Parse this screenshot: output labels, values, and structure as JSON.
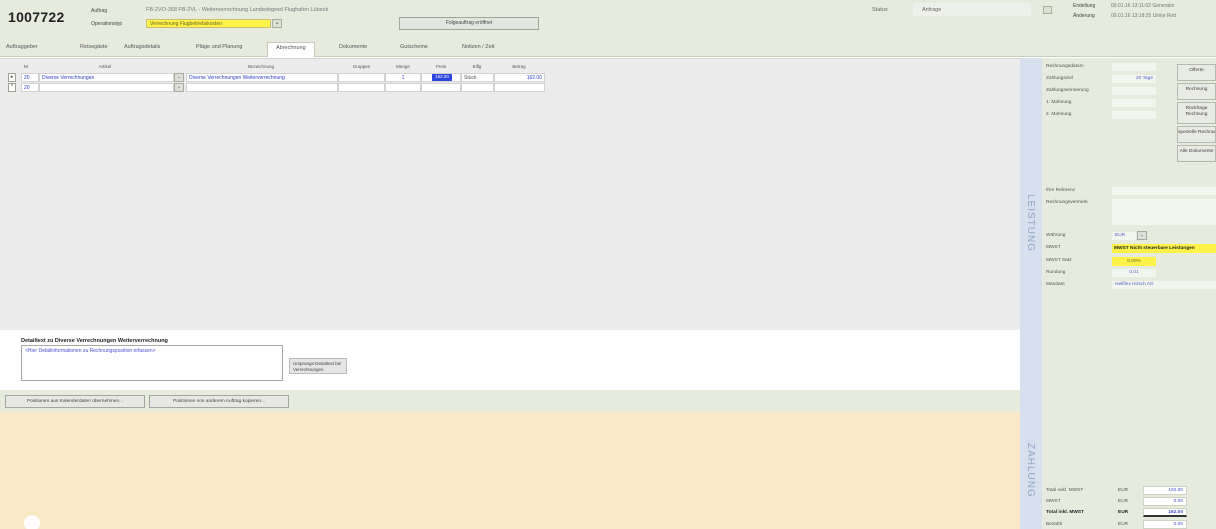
{
  "header": {
    "order_number": "1007722",
    "label_auftrag": "Auftrag",
    "label_operationstyp": "Operationstyp",
    "auftrag_value": "FB-2VO-368 FB-2VL - Weiterverrechnung Landedegesd Flughafen Lübeck",
    "operationstyp_value": "Verrechnung Flugbetriebskosten",
    "followup_button": "Folgeauftrag eröffnet",
    "status_label": "Status",
    "status_value": "Anfrage",
    "erstellung_label": "Erstellung",
    "erstellung_value": "09.01.16 13:11:02 Generator",
    "aenderung_label": "Änderung",
    "aenderung_value": "09.01.16 13:18:25 Ulrike Rott"
  },
  "tabs": [
    {
      "label": "Auftraggeber",
      "active": false
    },
    {
      "label": "Reisegäste",
      "active": false
    },
    {
      "label": "Auftragsdetails",
      "active": false
    },
    {
      "label": "Pläge und Planung",
      "active": false
    },
    {
      "label": "Abrechnung",
      "active": true
    },
    {
      "label": "Dokumente",
      "active": false
    },
    {
      "label": "Gutscheine",
      "active": false
    },
    {
      "label": "Notizen / Zeit",
      "active": false
    }
  ],
  "grid": {
    "columns": {
      "nr": "Nr",
      "artikel": "Artikel",
      "bezeichnung": "Bezeichnung",
      "gruppe": "Gruppen",
      "menge": "Menge",
      "preis": "Preis",
      "einheit": "Eiflg",
      "betrag": "Betrag"
    },
    "rows": [
      {
        "marker": "▸",
        "nr": "20",
        "artikel": "Diverse Verrechnungen",
        "bezeichnung": "Diverse Verrechnungen Weiterverrechnung",
        "gruppe": "",
        "menge": "1",
        "preis": "162.00",
        "einheit": "Stück",
        "betrag": "162.00"
      },
      {
        "marker": "*",
        "nr": "20",
        "artikel": "",
        "bezeichnung": "",
        "gruppe": "",
        "menge": "",
        "preis": "",
        "einheit": "",
        "betrag": ""
      }
    ]
  },
  "detail": {
    "title": "Detailtext zu Diverse Verrechnungen Weiterverrechnung",
    "placeholder": "<Hier Detailinformationen zu Rechnungsposition erfassen>",
    "button_label": "Ursprungs-Detailtext bei Verrechnungen"
  },
  "footer_buttons": {
    "from_calendar": "Positionen aus Kalenderdaten übernehmen...",
    "copy_from_order": "Positionen von anderem Auftrag kopieren..."
  },
  "side_strip": {
    "leistung": "LEISTUNG",
    "zahlung": "ZAHLUNG"
  },
  "right_panel": {
    "rechnungsdatum_label": "Rechnungsdatum",
    "zahlungsziel_label": "Zahlungsziel",
    "zahlungsziel_value": "20 Tage",
    "zahlungserinnerung_label": "Zahlungserinnerung",
    "mahnung1_label": "1. Mahnung",
    "mahnung2_label": "2. Mahnung",
    "btn_offerte": "Offerte",
    "btn_rechnung": "Rechnung",
    "btn_rueckfrage": "Rückfrage Rechnung",
    "btn_spezielle": "spezielle Rechnung",
    "btn_alle": "Alle Dokumente",
    "ihre_referenz_label": "Ihre Referenz",
    "rechnungsvermerk_label": "Rechnungsvermerk",
    "waehrung_label": "Währung",
    "waehrung_value": "EUR",
    "mwst_label": "MWST",
    "mwst_value": "MWST Nicht steuerbare Leistungen",
    "mwst_satz_label": "MWST Satz",
    "mwst_satz_value": "0.00%",
    "rundung_label": "Rundung",
    "rundung_value": "0.01",
    "mandant_label": "Mandant",
    "mandant_value": "Heliflex Hirsch AG",
    "totals": [
      {
        "label": "Total exkl. MWST",
        "currency": "EUR",
        "value": "162.00",
        "bold": false
      },
      {
        "label": "MWST",
        "currency": "EUR",
        "value": "0.00",
        "bold": false
      },
      {
        "label": "Total inkl. MWST",
        "currency": "EUR",
        "value": "162.00",
        "bold": true
      },
      {
        "label": "Bezahlt",
        "currency": "EUR",
        "value": "0.00",
        "bold": false
      }
    ]
  },
  "colors": {
    "header_bg": "#e6ebdd",
    "highlight_yellow": "#fff34a",
    "peach": "#fbe8c7",
    "side_strip": "#d7e0ee",
    "link_blue": "#2b3bc2",
    "selected_cell": "#2f45e0"
  },
  "icons": {
    "dropdown": "chevron-down-icon",
    "row_current": "current-row-icon",
    "row_new": "new-row-icon"
  }
}
